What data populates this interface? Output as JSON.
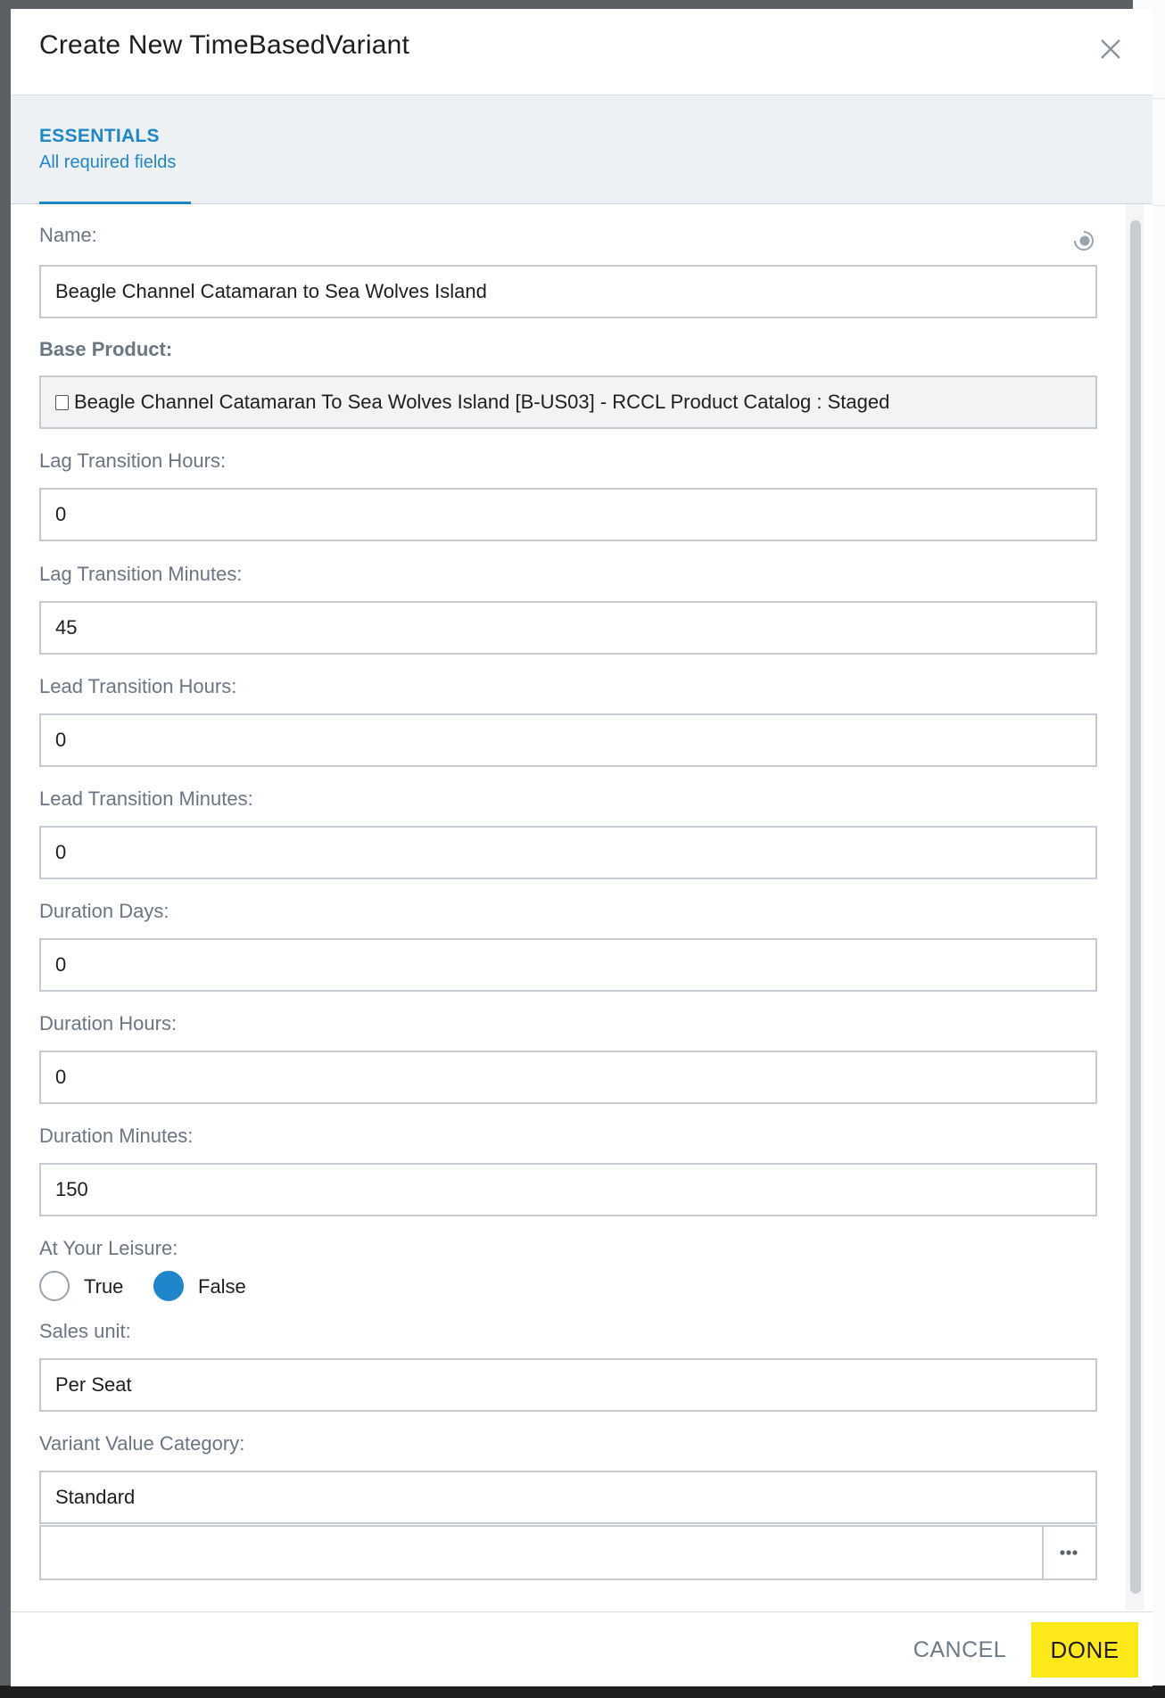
{
  "dialog": {
    "title": "Create New TimeBasedVariant",
    "close_icon": "close-icon"
  },
  "tabs": [
    {
      "label": "ESSENTIALS",
      "subtitle": "All required fields",
      "active": true
    }
  ],
  "fields": {
    "name": {
      "label": "Name:",
      "value": "Beagle Channel Catamaran to Sea Wolves Island"
    },
    "base_product": {
      "label": "Base Product:",
      "value": "Beagle Channel Catamaran To Sea Wolves Island [B-US03] - RCCL Product Catalog : Staged"
    },
    "lag_hours": {
      "label": "Lag Transition Hours:",
      "value": "0"
    },
    "lag_minutes": {
      "label": "Lag Transition Minutes:",
      "value": "45"
    },
    "lead_hours": {
      "label": "Lead Transition Hours:",
      "value": "0"
    },
    "lead_minutes": {
      "label": "Lead Transition Minutes:",
      "value": "0"
    },
    "duration_days": {
      "label": "Duration Days:",
      "value": "0"
    },
    "duration_hours": {
      "label": "Duration Hours:",
      "value": "0"
    },
    "duration_minutes": {
      "label": "Duration Minutes:",
      "value": "150"
    },
    "at_your_leisure": {
      "label": "At Your Leisure:",
      "option_true": "True",
      "option_false": "False",
      "selected": "False"
    },
    "sales_unit": {
      "label": "Sales unit:",
      "value": "Per Seat"
    },
    "variant_value_category": {
      "label": "Variant Value Category:",
      "value": "Standard",
      "picker_value": ""
    }
  },
  "footer": {
    "cancel_label": "CANCEL",
    "done_label": "DONE"
  },
  "colors": {
    "accent": "#1f86cc",
    "done_button": "#fde81a"
  }
}
